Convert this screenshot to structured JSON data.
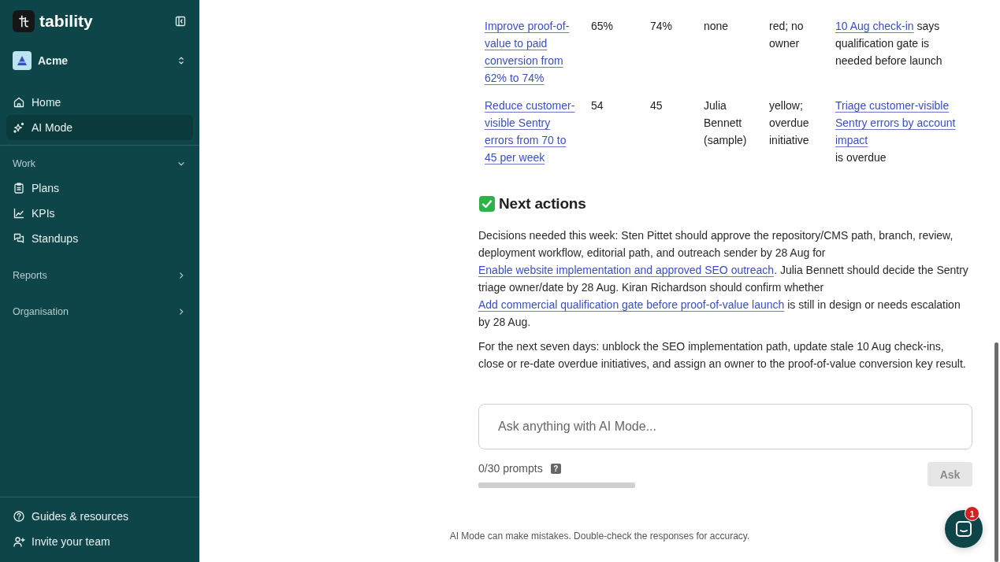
{
  "sidebar": {
    "brand": "tability",
    "workspace": "Acme",
    "nav": [
      {
        "label": "Home",
        "selected": false
      },
      {
        "label": "AI Mode",
        "selected": true
      }
    ],
    "sections": [
      {
        "label": "Work",
        "expanded": true,
        "items": [
          {
            "label": "Plans"
          },
          {
            "label": "KPIs"
          },
          {
            "label": "Standups"
          }
        ]
      },
      {
        "label": "Reports",
        "expanded": false
      },
      {
        "label": "Organisation",
        "expanded": false
      }
    ],
    "footer": [
      {
        "label": "Guides & resources"
      },
      {
        "label": "Invite your team"
      }
    ]
  },
  "table": {
    "rows": [
      [
        [
          {
            "kind": "link",
            "text": "Improve proof-of-value to paid conversion from 62% to 74%"
          }
        ],
        [
          {
            "kind": "text",
            "text": "65%"
          }
        ],
        [
          {
            "kind": "text",
            "text": "74%"
          }
        ],
        [
          {
            "kind": "text",
            "text": "none"
          }
        ],
        [
          {
            "kind": "text",
            "text": "red; no owner"
          }
        ],
        [
          {
            "kind": "link",
            "text": "10 Aug check-in"
          },
          {
            "kind": "text",
            "text": " says qualification gate is needed before launch"
          }
        ]
      ],
      [
        [
          {
            "kind": "link",
            "text": "Reduce customer-visible Sentry errors from 70 to 45 per week"
          }
        ],
        [
          {
            "kind": "text",
            "text": "54"
          }
        ],
        [
          {
            "kind": "text",
            "text": "45"
          }
        ],
        [
          {
            "kind": "text",
            "text": "Julia Bennett (sample)"
          }
        ],
        [
          {
            "kind": "text",
            "text": "yellow; overdue initiative"
          }
        ],
        [
          {
            "kind": "link",
            "text": "Triage customer-visible Sentry errors by account impact"
          },
          {
            "kind": "text",
            "text": " is overdue"
          }
        ]
      ]
    ]
  },
  "next_actions": {
    "title": "Next actions",
    "paragraphs": [
      [
        {
          "kind": "text",
          "text": "Decisions needed this week: Sten Pittet should approve the repository/CMS path, branch, review, deployment workflow, editorial path, and outreach sender by 28 Aug for "
        },
        {
          "kind": "link",
          "text": "Enable website implementation and approved SEO outreach"
        },
        {
          "kind": "text",
          "text": ". Julia Bennett should decide the Sentry triage owner/date by 28 Aug. Kiran Richardson should confirm whether "
        },
        {
          "kind": "link",
          "text": "Add commercial qualification gate before proof-of-value launch"
        },
        {
          "kind": "text",
          "text": " is still in design or needs escalation by 28 Aug."
        }
      ],
      [
        {
          "kind": "text",
          "text": "For the next seven days: unblock the SEO implementation path, update stale 10 Aug check-ins, close or re-date overdue initiatives, and assign an owner to the proof-of-value conversion key result."
        }
      ]
    ]
  },
  "prompt": {
    "placeholder": "Ask anything with AI Mode...",
    "counter": "0/30 prompts",
    "help": "?",
    "ask_button": {
      "label": "Ask",
      "disabled": true
    }
  },
  "disclaimer": "AI Mode can make mistakes. Double-check the responses for accuracy.",
  "chat": {
    "badge": "1"
  }
}
